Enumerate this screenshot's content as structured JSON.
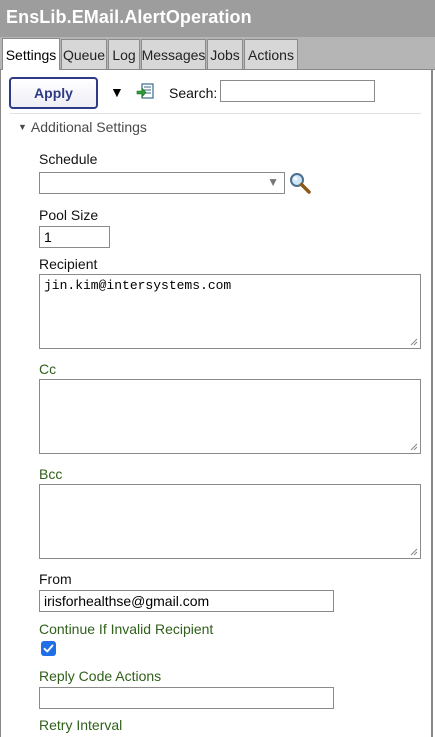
{
  "window": {
    "title": "EnsLib.EMail.AlertOperation"
  },
  "tabs": [
    {
      "label": "Settings",
      "active": true
    },
    {
      "label": "Queue"
    },
    {
      "label": "Log"
    },
    {
      "label": "Messages"
    },
    {
      "label": "Jobs"
    },
    {
      "label": "Actions"
    }
  ],
  "toolbar": {
    "apply_label": "Apply",
    "search_label": "Search:",
    "search_value": "",
    "dropdown_icon": "triangle-down-icon",
    "export_icon": "export-icon"
  },
  "section": {
    "label": "Additional Settings",
    "expanded": true
  },
  "fields": {
    "schedule": {
      "label": "Schedule",
      "value": "",
      "lookup_icon": "magnifier-icon"
    },
    "pool_size": {
      "label": "Pool Size",
      "value": "1"
    },
    "recipient": {
      "label": "Recipient",
      "value": "jin.kim@intersystems.com"
    },
    "cc": {
      "label": "Cc",
      "value": ""
    },
    "bcc": {
      "label": "Bcc",
      "value": ""
    },
    "from": {
      "label": "From",
      "value": "irisforhealthse@gmail.com"
    },
    "continue_if_invalid": {
      "label": "Continue If Invalid Recipient",
      "checked": true
    },
    "reply_code_actions": {
      "label": "Reply Code Actions",
      "value": ""
    },
    "retry_interval": {
      "label": "Retry Interval"
    }
  },
  "colors": {
    "title_bar": "#9d9d9d",
    "accent": "#2e3a86",
    "label_green": "#2f5f1a",
    "checkbox": "#1e6fe8"
  }
}
